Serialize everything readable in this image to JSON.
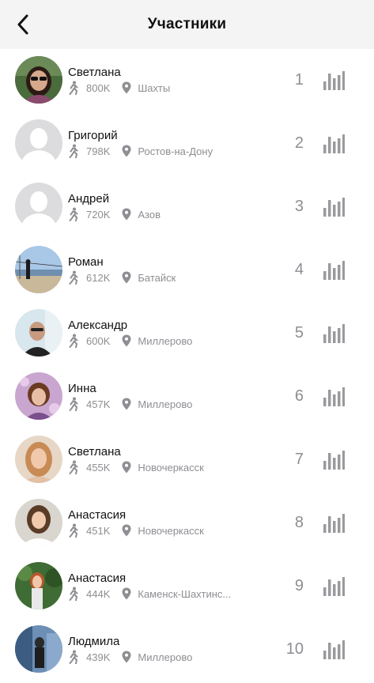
{
  "header": {
    "title": "Участники",
    "back_icon": "chevron-left-icon"
  },
  "colors": {
    "muted": "#8e8e93",
    "header_bg": "#f4f4f5",
    "bars": "#9a9a9e"
  },
  "participants": [
    {
      "name": "Светлана",
      "steps": "800K",
      "city": "Шахты",
      "rank": "1",
      "avatar": "photo"
    },
    {
      "name": "Григорий",
      "steps": "798K",
      "city": "Ростов-на-Дону",
      "rank": "2",
      "avatar": "placeholder"
    },
    {
      "name": "Андрей",
      "steps": "720K",
      "city": "Азов",
      "rank": "3",
      "avatar": "placeholder"
    },
    {
      "name": "Роман",
      "steps": "612K",
      "city": "Батайск",
      "rank": "4",
      "avatar": "photo"
    },
    {
      "name": "Александр",
      "steps": "600K",
      "city": "Миллерово",
      "rank": "5",
      "avatar": "photo"
    },
    {
      "name": "Инна",
      "steps": "457K",
      "city": "Миллерово",
      "rank": "6",
      "avatar": "photo"
    },
    {
      "name": "Светлана",
      "steps": "455K",
      "city": "Новочеркасск",
      "rank": "7",
      "avatar": "photo"
    },
    {
      "name": "Анастасия",
      "steps": "451K",
      "city": "Новочеркасск",
      "rank": "8",
      "avatar": "photo"
    },
    {
      "name": "Анастасия",
      "steps": "444K",
      "city": "Каменск-Шахтинс...",
      "rank": "9",
      "avatar": "photo"
    },
    {
      "name": "Людмила",
      "steps": "439K",
      "city": "Миллерово",
      "rank": "10",
      "avatar": "photo"
    }
  ]
}
